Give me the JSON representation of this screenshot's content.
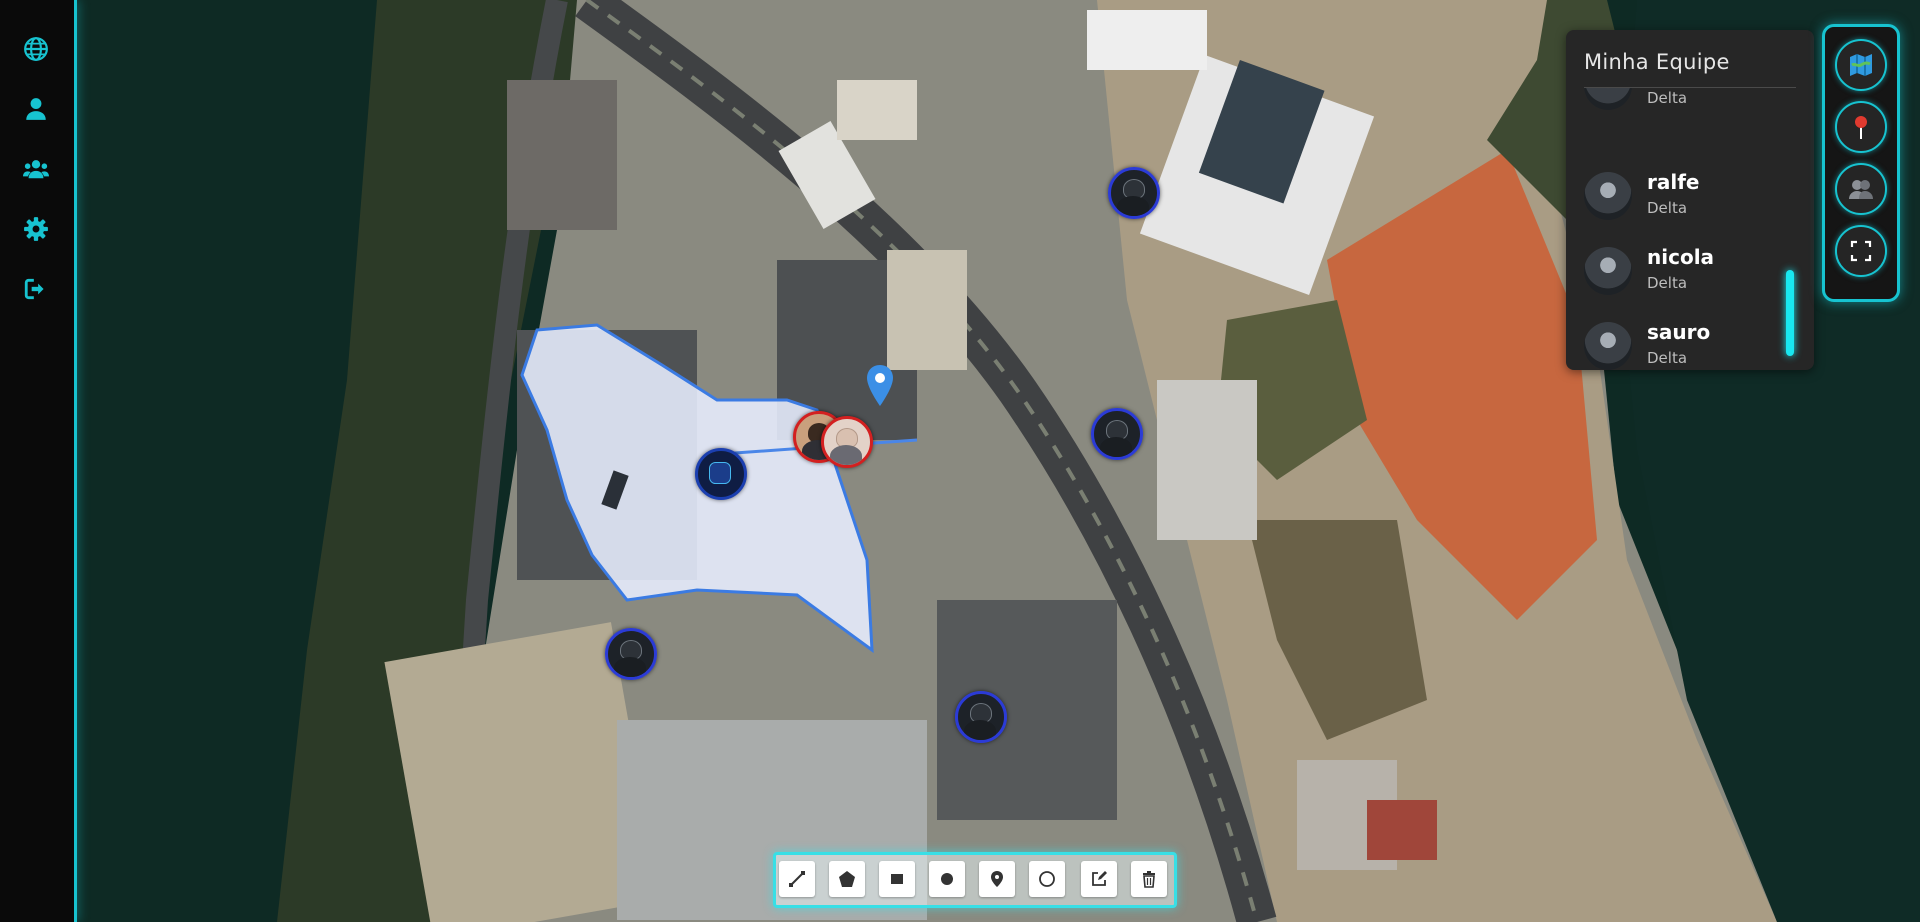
{
  "sidebar": {
    "items": [
      {
        "name": "globe-icon"
      },
      {
        "name": "user-icon"
      },
      {
        "name": "users-icon"
      },
      {
        "name": "gear-icon"
      },
      {
        "name": "logout-icon"
      }
    ],
    "accent": "#17c3d0"
  },
  "team": {
    "title": "Minha Equipe",
    "members": [
      {
        "name": "",
        "group": "Delta"
      },
      {
        "name": "ralfe",
        "group": "Delta"
      },
      {
        "name": "nicola",
        "group": "Delta"
      },
      {
        "name": "sauro",
        "group": "Delta"
      }
    ]
  },
  "right_tools": [
    {
      "name": "map-icon"
    },
    {
      "name": "pin-icon"
    },
    {
      "name": "team-icon"
    },
    {
      "name": "fullscreen-icon"
    }
  ],
  "draw_tools": [
    {
      "name": "polyline-icon"
    },
    {
      "name": "polygon-icon"
    },
    {
      "name": "rectangle-icon"
    },
    {
      "name": "circle-marker-icon"
    },
    {
      "name": "marker-icon"
    },
    {
      "name": "circle-icon"
    },
    {
      "name": "edit-icon"
    },
    {
      "name": "trash-icon"
    }
  ],
  "colors": {
    "accent": "#17c3d0",
    "zone_fill": "#e8eeff",
    "zone_stroke": "#3b7be3",
    "marker_blue": "#2b3bd6",
    "marker_red": "#d32020",
    "scroll_thumb": "#19e8f0"
  }
}
